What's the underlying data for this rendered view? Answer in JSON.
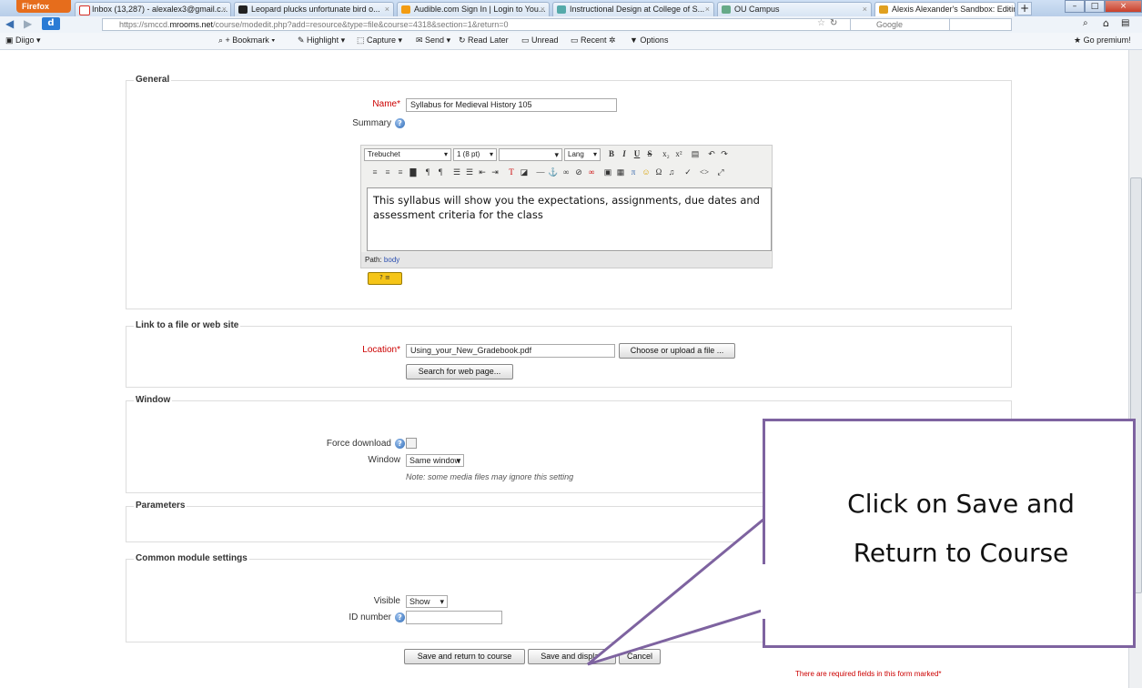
{
  "browser": {
    "firefox_button": "Firefox",
    "tabs": [
      {
        "label": "Inbox (13,287) - alexalex3@gmail.c...",
        "icon_color": "#d93025"
      },
      {
        "label": "Leopard plucks unfortunate bird o...",
        "icon_color": "#222"
      },
      {
        "label": "Audible.com Sign In | Login to You...",
        "icon_color": "#f39c12"
      },
      {
        "label": "Instructional Design at College of S...",
        "icon_color": "#5aa"
      },
      {
        "label": "OU Campus",
        "icon_color": "#6a8"
      },
      {
        "label": "Alexis Alexander's Sandbox: Editing...",
        "icon_color": "#e0a020"
      }
    ],
    "new_tab": "+",
    "url_prefix": "https://smccd.",
    "url_domain": "mrooms.net",
    "url_rest": "/course/modedit.php?add=resource&type=file&course=4318&section=1&return=0",
    "search_placeholder": "Google",
    "bookmarks": {
      "diigo": "Diigo",
      "bookmark": "Bookmark",
      "highlight": "Highlight",
      "capture": "Capture",
      "send": "Send",
      "read_later": "Read Later",
      "unread": "Unread",
      "recent": "Recent",
      "options": "Options",
      "go_premium": "Go premium!"
    }
  },
  "form": {
    "general": {
      "legend": "General",
      "name_label": "Name",
      "name_value": "Syllabus for Medieval History 105",
      "summary_label": "Summary",
      "editor": {
        "font": "Trebuchet",
        "size": "1 (8 pt)",
        "lang": "Lang",
        "content": "This syllabus will show you the expectations, assignments, due dates and assessment criteria for the class",
        "path_label": "Path:",
        "path_value": "body"
      }
    },
    "link": {
      "legend": "Link to a file or web site",
      "location_label": "Location",
      "location_value": "Using_your_New_Gradebook.pdf",
      "choose_button": "Choose or upload a file ...",
      "search_button": "Search for web page..."
    },
    "window": {
      "legend": "Window",
      "force_download_label": "Force download",
      "window_label": "Window",
      "window_value": "Same window",
      "note": "Note: some media files may ignore this setting"
    },
    "parameters": {
      "legend": "Parameters"
    },
    "common": {
      "legend": "Common module settings",
      "visible_label": "Visible",
      "visible_value": "Show",
      "id_label": "ID number",
      "id_value": ""
    },
    "buttons": {
      "save_return": "Save and return to course",
      "save_display": "Save and display",
      "cancel": "Cancel"
    },
    "required_note": "There are required fields in this form marked"
  },
  "callout": {
    "line1": "Click on Save and",
    "line2": "Return to Course",
    "border_color": "#7e63a0"
  }
}
